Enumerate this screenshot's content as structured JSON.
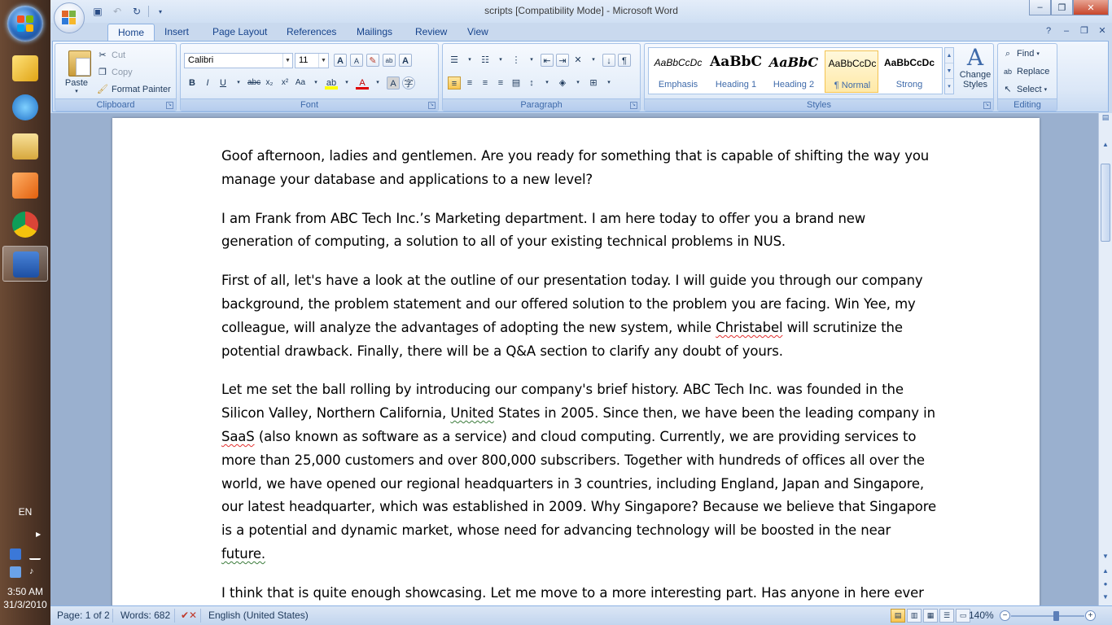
{
  "taskbar": {
    "language": "EN",
    "time": "3:50 AM",
    "date": "31/3/2010",
    "apps": [
      "outlook-icon",
      "internet-explorer-icon",
      "file-manager-icon",
      "media-player-icon",
      "chrome-icon",
      "word-icon"
    ]
  },
  "window": {
    "title": "scripts [Compatibility Mode] - Microsoft Word"
  },
  "tabs": [
    "Home",
    "Insert",
    "Page Layout",
    "References",
    "Mailings",
    "Review",
    "View"
  ],
  "ribbon": {
    "clipboard": {
      "label": "Clipboard",
      "paste": "Paste",
      "cut": "Cut",
      "copy": "Copy",
      "format_painter": "Format Painter"
    },
    "font": {
      "label": "Font",
      "font_name": "Calibri",
      "font_size": "11"
    },
    "paragraph": {
      "label": "Paragraph"
    },
    "styles": {
      "label": "Styles",
      "items": [
        {
          "preview": "AaBbCcDc",
          "name": "Emphasis"
        },
        {
          "preview": "AaBbC",
          "name": "Heading 1"
        },
        {
          "preview": "AaBbC",
          "name": "Heading 2"
        },
        {
          "preview": "AaBbCcDc",
          "name": "¶ Normal"
        },
        {
          "preview": "AaBbCcDc",
          "name": "Strong"
        }
      ],
      "change_styles_line1": "Change",
      "change_styles_line2": "Styles"
    },
    "editing": {
      "label": "Editing",
      "find": "Find",
      "replace": "Replace",
      "select": "Select"
    }
  },
  "document": {
    "p1": "Goof afternoon, ladies and gentlemen. Are you ready for something that is capable of shifting the way you manage your database and applications to a new level?",
    "p2": "I am Frank from ABC Tech Inc.’s Marketing department. I am here today to offer you a brand new generation of computing, a solution to all of your existing technical problems in NUS.",
    "p3a": "First of all, let's have a look at the outline of our presentation today. I will guide you through our company background, the problem statement and our offered solution to the problem you are facing. Win Yee, my colleague, will analyze the advantages of adopting the new system, while ",
    "p3b": "Christabel",
    "p3c": " will scrutinize the potential drawback. Finally, there will be a Q&A section to clarify any doubt of yours.",
    "p4a": "Let me set the ball rolling by introducing our company's brief history. ABC Tech Inc. was founded in the Silicon Valley, Northern California, ",
    "p4b": "United",
    "p4c": " States in 2005. Since then, we have been the leading company in ",
    "p4d": "SaaS",
    "p4e": " (also known as software as a service) and cloud computing. Currently, we are providing services to more than 25,000 customers and over 800,000 subscribers. Together with hundreds of offices all over the world, we have opened our regional headquarters in 3 countries, including England, Japan and Singapore, our latest headquarter, which was established in 2009. Why Singapore? Because we believe that Singapore is a potential and dynamic market, whose need for advancing technology will be boosted in the near ",
    "p4f": "future.",
    "p5": "I think that is quite enough showcasing. Let me move to a more interesting part. Has anyone in here ever experienced any problem hosting in NUS server?"
  },
  "status": {
    "page": "Page: 1 of 2",
    "words": "Words: 682",
    "language": "English (United States)",
    "zoom": "140%"
  },
  "colors": {
    "ribbon": "#dbe7f7",
    "accent": "#15428b",
    "spelling": "#e2302f"
  }
}
